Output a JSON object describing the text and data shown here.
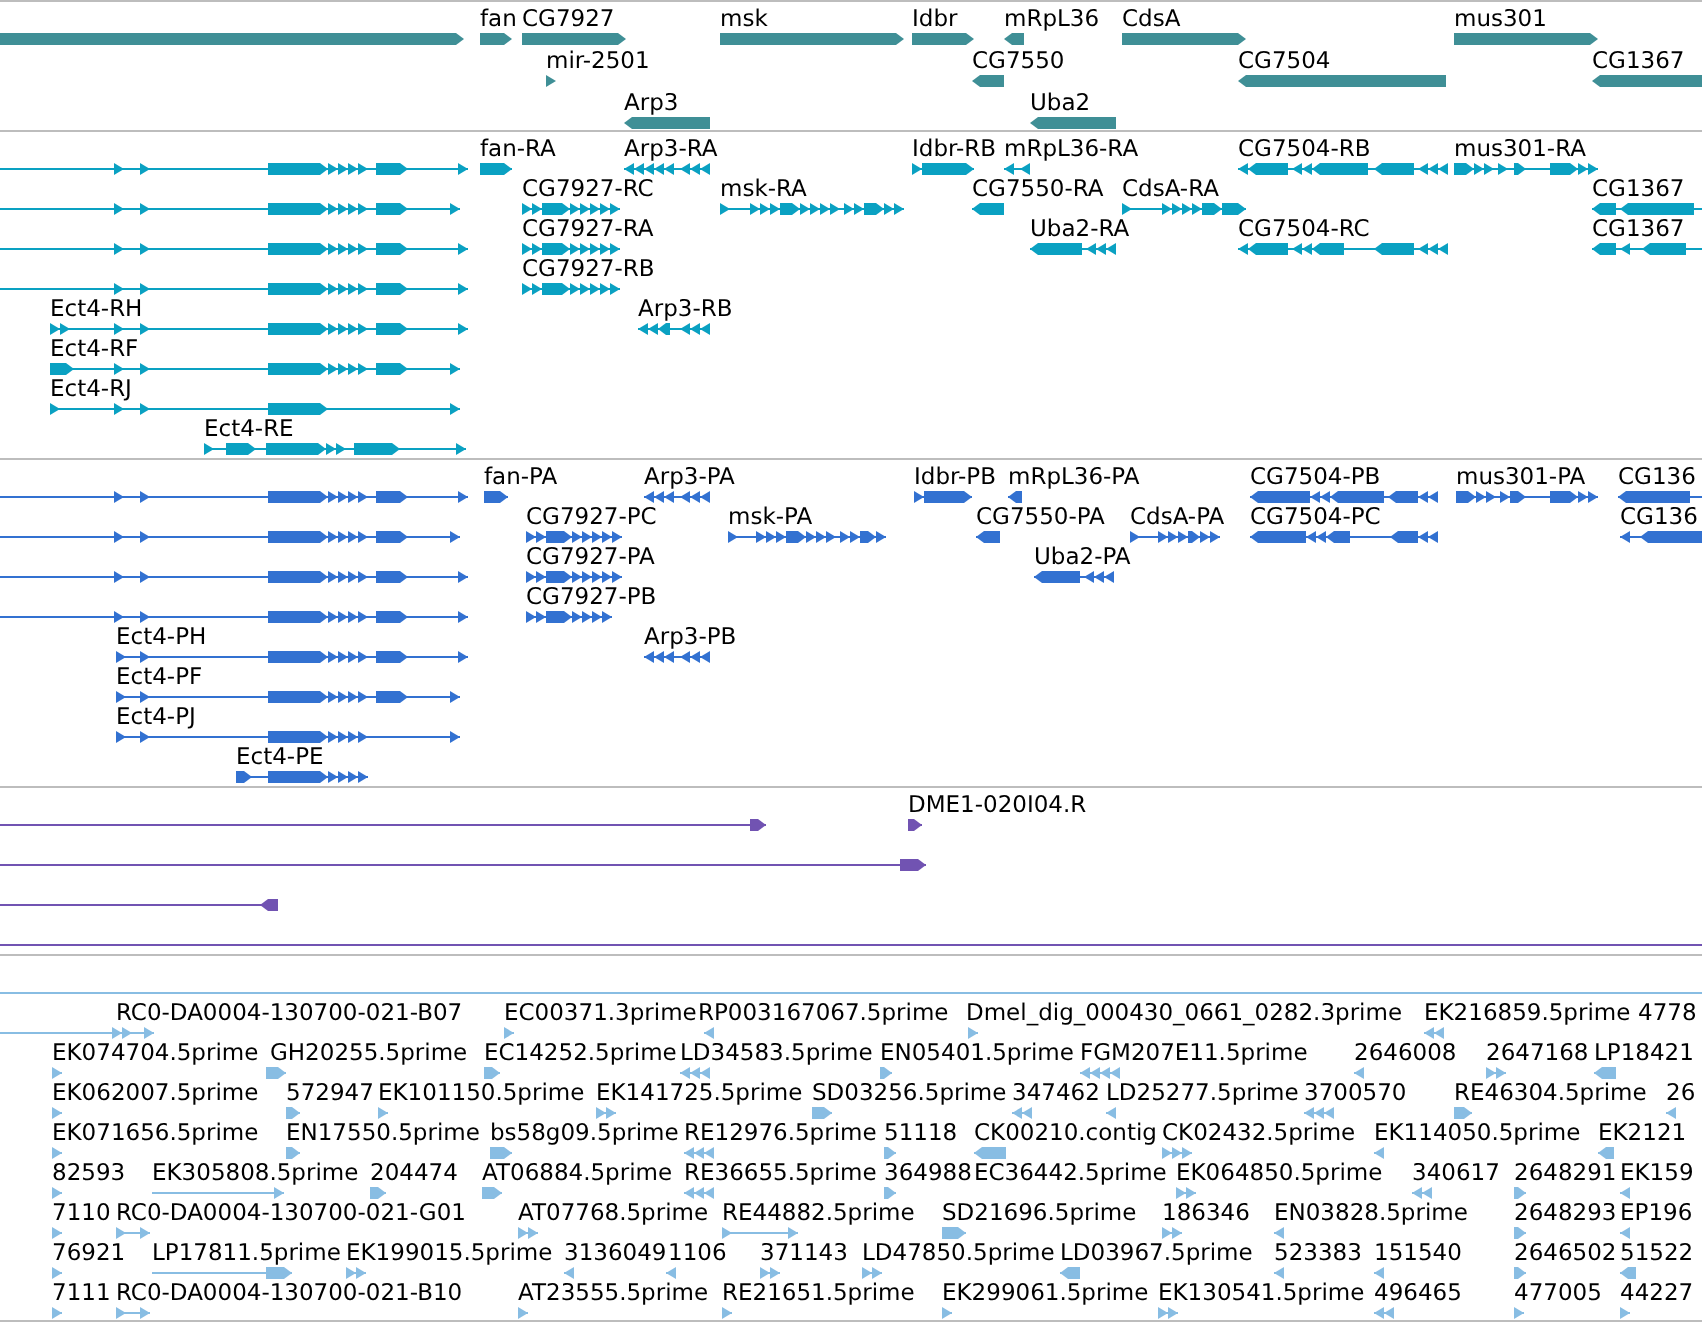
{
  "tracks": [
    {
      "kind": "gene",
      "rows": [
        {
          "features": [
            {
              "reverse": false
            },
            {
              "label": "fan",
              "reverse": false
            },
            {
              "label": "CG7927",
              "reverse": false
            },
            {
              "label": "msk",
              "reverse": false
            },
            {
              "label": "Idbr",
              "reverse": false
            },
            {
              "label": "mRpL36",
              "reverse": true
            },
            {
              "label": "CdsA",
              "reverse": false
            },
            {
              "label": "mus301",
              "reverse": false
            }
          ]
        },
        {
          "features": [
            {
              "label": "mir-2501",
              "reverse": false
            },
            {
              "label": "CG7550",
              "reverse": true
            },
            {
              "label": "CG7504",
              "reverse": true
            },
            {
              "label": "CG1367",
              "reverse": true
            }
          ]
        },
        {
          "features": [
            {
              "label": "Arp3",
              "reverse": true
            },
            {
              "label": "Uba2",
              "reverse": true
            }
          ]
        }
      ]
    },
    {
      "kind": "transcript",
      "rows": [
        {
          "features": [
            {
              "reverse": false
            },
            {
              "label": "fan-RA",
              "reverse": false
            },
            {
              "label": "Arp3-RA",
              "reverse": true
            },
            {
              "label": "Idbr-RB",
              "reverse": false
            },
            {
              "label": "mRpL36-RA",
              "reverse": true
            },
            {
              "label": "CG7504-RB",
              "reverse": true
            },
            {
              "label": "mus301-RA",
              "reverse": false
            }
          ]
        },
        {
          "features": [
            {
              "reverse": false
            },
            {
              "label": "CG7927-RC",
              "reverse": false
            },
            {
              "label": "msk-RA",
              "reverse": false
            },
            {
              "label": "CG7550-RA",
              "reverse": true
            },
            {
              "label": "CdsA-RA",
              "reverse": false
            },
            {
              "label": "CG1367",
              "reverse": true
            }
          ]
        },
        {
          "features": [
            {
              "reverse": false
            },
            {
              "label": "CG7927-RA",
              "reverse": false
            },
            {
              "label": "Uba2-RA",
              "reverse": true
            },
            {
              "label": "CG7504-RC",
              "reverse": true
            },
            {
              "label": "CG1367",
              "reverse": true
            }
          ]
        },
        {
          "features": [
            {
              "reverse": false
            },
            {
              "label": "CG7927-RB",
              "reverse": false
            }
          ]
        },
        {
          "features": [
            {
              "label": "Ect4-RH",
              "reverse": false
            },
            {
              "label": "Arp3-RB",
              "reverse": true
            }
          ]
        },
        {
          "features": [
            {
              "label": "Ect4-RF",
              "reverse": false
            }
          ]
        },
        {
          "features": [
            {
              "label": "Ect4-RJ",
              "reverse": false
            }
          ]
        },
        {
          "features": [
            {
              "label": "Ect4-RE",
              "reverse": false
            }
          ]
        }
      ]
    },
    {
      "kind": "protein",
      "rows": [
        {
          "features": [
            {
              "reverse": false
            },
            {
              "label": "fan-PA",
              "reverse": false
            },
            {
              "label": "Arp3-PA",
              "reverse": true
            },
            {
              "label": "Idbr-PB",
              "reverse": false
            },
            {
              "label": "mRpL36-PA",
              "reverse": true
            },
            {
              "label": "CG7504-PB",
              "reverse": true
            },
            {
              "label": "mus301-PA",
              "reverse": false
            },
            {
              "label": "CG136",
              "reverse": true
            }
          ]
        },
        {
          "features": [
            {
              "reverse": false
            },
            {
              "label": "CG7927-PC",
              "reverse": false
            },
            {
              "label": "msk-PA",
              "reverse": false
            },
            {
              "label": "CG7550-PA",
              "reverse": true
            },
            {
              "label": "CdsA-PA",
              "reverse": false
            },
            {
              "label": "CG7504-PC",
              "reverse": true
            },
            {
              "label": "CG136",
              "reverse": true
            }
          ]
        },
        {
          "features": [
            {
              "reverse": false
            },
            {
              "label": "CG7927-PA",
              "reverse": false
            },
            {
              "label": "Uba2-PA",
              "reverse": true
            }
          ]
        },
        {
          "features": [
            {
              "reverse": false
            },
            {
              "label": "CG7927-PB",
              "reverse": false
            }
          ]
        },
        {
          "features": [
            {
              "label": "Ect4-PH",
              "reverse": false
            },
            {
              "label": "Arp3-PB",
              "reverse": true
            }
          ]
        },
        {
          "features": [
            {
              "label": "Ect4-PF",
              "reverse": false
            }
          ]
        },
        {
          "features": [
            {
              "label": "Ect4-PJ",
              "reverse": false
            }
          ]
        },
        {
          "features": [
            {
              "label": "Ect4-PE",
              "reverse": false
            }
          ]
        }
      ]
    },
    {
      "kind": "clone",
      "rows": [
        {
          "features": [
            {
              "reverse": false
            },
            {
              "label": "DME1-020I04.R",
              "reverse": false
            }
          ]
        },
        {
          "features": [
            {
              "reverse": false
            }
          ]
        },
        {
          "features": [
            {
              "reverse": true
            }
          ]
        },
        {
          "spanning_line": true
        }
      ]
    },
    {
      "kind": "est",
      "rows": [
        {
          "spanning_line": true
        },
        {
          "features": [
            {
              "label": "RC0-DA0004-130700-021-B07",
              "reverse": false
            },
            {
              "label": "EC00371.3prime",
              "reverse": false
            },
            {
              "label": "RP003167067.5prime",
              "reverse": true
            },
            {
              "label": "Dmel_dig_000430_0661_0282.3prime",
              "reverse": false
            },
            {
              "label": "EK216859.5prime",
              "reverse": true
            },
            {
              "label": "4778"
            }
          ]
        },
        {
          "features": [
            {
              "label": "EK074704.5prime",
              "reverse": false
            },
            {
              "label": "GH20255.5prime",
              "reverse": false
            },
            {
              "label": "EC14252.5prime",
              "reverse": false
            },
            {
              "label": "LD34583.5prime",
              "reverse": true
            },
            {
              "label": "EN05401.5prime",
              "reverse": false
            },
            {
              "label": "FGM207E11.5prime",
              "reverse": true
            },
            {
              "label": "2646008",
              "reverse": true
            },
            {
              "label": "2647168",
              "reverse": false
            },
            {
              "label": "LP18421",
              "reverse": true
            }
          ]
        },
        {
          "features": [
            {
              "label": "EK062007.5prime",
              "reverse": false
            },
            {
              "label": "572947",
              "reverse": false
            },
            {
              "label": "EK101150.5prime",
              "reverse": false
            },
            {
              "label": "EK141725.5prime",
              "reverse": false
            },
            {
              "label": "SD03256.5prime",
              "reverse": false
            },
            {
              "label": "347462",
              "reverse": true
            },
            {
              "label": "LD25277.5prime",
              "reverse": true
            },
            {
              "label": "3700570",
              "reverse": true
            },
            {
              "label": "RE46304.5prime",
              "reverse": false
            },
            {
              "label": "26",
              "reverse": true
            }
          ]
        },
        {
          "features": [
            {
              "label": "EK071656.5prime",
              "reverse": false
            },
            {
              "label": "EN17550.5prime",
              "reverse": false
            },
            {
              "label": "bs58g09.5prime",
              "reverse": false
            },
            {
              "label": "RE12976.5prime",
              "reverse": true
            },
            {
              "label": "51118",
              "reverse": false
            },
            {
              "label": "CK00210.contig",
              "reverse": true
            },
            {
              "label": "CK02432.5prime",
              "reverse": false
            },
            {
              "label": "EK114050.5prime",
              "reverse": true
            },
            {
              "label": "EK2121",
              "reverse": true
            }
          ]
        },
        {
          "features": [
            {
              "label": "82593",
              "reverse": false
            },
            {
              "label": "EK305808.5prime",
              "reverse": false
            },
            {
              "label": "204474",
              "reverse": false
            },
            {
              "label": "AT06884.5prime",
              "reverse": false
            },
            {
              "label": "RE36655.5prime",
              "reverse": true
            },
            {
              "label": "364988",
              "reverse": false
            },
            {
              "label": "EC36442.5prime"
            },
            {
              "label": "EK064850.5prime",
              "reverse": false
            },
            {
              "label": "340617",
              "reverse": true
            },
            {
              "label": "2648291",
              "reverse": false
            },
            {
              "label": "EK159",
              "reverse": true
            }
          ]
        },
        {
          "features": [
            {
              "label": "7110",
              "reverse": false
            },
            {
              "label": "RC0-DA0004-130700-021-G01",
              "reverse": false
            },
            {
              "label": "AT07768.5prime",
              "reverse": false
            },
            {
              "label": "RE44882.5prime",
              "reverse": false
            },
            {
              "label": "SD21696.5prime",
              "reverse": false
            },
            {
              "label": "186346",
              "reverse": false
            },
            {
              "label": "EN03828.5prime",
              "reverse": true
            },
            {
              "label": "2648293",
              "reverse": false
            },
            {
              "label": "EP196",
              "reverse": true
            }
          ]
        },
        {
          "features": [
            {
              "label": "76921",
              "reverse": false
            },
            {
              "label": "LP17811.5prime",
              "reverse": false
            },
            {
              "label": "EK199015.5prime",
              "reverse": false
            },
            {
              "label": "3136049",
              "reverse": true
            },
            {
              "label": "1106",
              "reverse": true
            },
            {
              "label": "371143",
              "reverse": false
            },
            {
              "label": "LD47850.5prime",
              "reverse": false
            },
            {
              "label": "LD03967.5prime",
              "reverse": true
            },
            {
              "label": "523383",
              "reverse": true
            },
            {
              "label": "151540",
              "reverse": true
            },
            {
              "label": "2646502",
              "reverse": false
            },
            {
              "label": "51522",
              "reverse": true
            }
          ]
        },
        {
          "features": [
            {
              "label": "7111",
              "reverse": false
            },
            {
              "label": "RC0-DA0004-130700-021-B10",
              "reverse": false
            },
            {
              "label": "AT23555.5prime",
              "reverse": false
            },
            {
              "label": "RE21651.5prime",
              "reverse": false
            },
            {
              "label": "EK299061.5prime",
              "reverse": false
            },
            {
              "label": "EK130541.5prime",
              "reverse": false
            },
            {
              "label": "496465",
              "reverse": true
            },
            {
              "label": "477005",
              "reverse": false
            },
            {
              "label": "44227",
              "reverse": false
            }
          ]
        }
      ]
    }
  ]
}
